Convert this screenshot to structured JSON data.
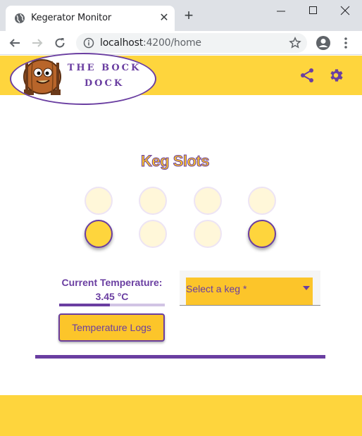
{
  "browser": {
    "tab_title": "Kegerator Monitor",
    "new_tab": "+",
    "url_host": "localhost",
    "url_path": ":4200/home",
    "window_controls": {
      "minimize": "minimize-icon",
      "maximize": "maximize-icon",
      "close": "close-icon"
    }
  },
  "header": {
    "logo_line1": "THE BOCK",
    "logo_line2": "DOCK",
    "icons": {
      "share": "share-icon",
      "settings": "gear-icon"
    }
  },
  "main": {
    "title": "Keg Slots",
    "slots": [
      {
        "filled": false
      },
      {
        "filled": false
      },
      {
        "filled": false
      },
      {
        "filled": false
      },
      {
        "filled": true
      },
      {
        "filled": false
      },
      {
        "filled": false
      },
      {
        "filled": true
      }
    ],
    "temperature": {
      "label": "Current Temperature:",
      "value": "3.45 °C",
      "progress": 0.48
    },
    "keg_select": {
      "placeholder": "Select a keg *"
    },
    "logs_button": "Temperature Logs"
  },
  "colors": {
    "primary": "#6a3ea1",
    "accent": "#fed53d",
    "accent_dark": "#fcc52a",
    "slot_empty": "#fff7d9"
  }
}
